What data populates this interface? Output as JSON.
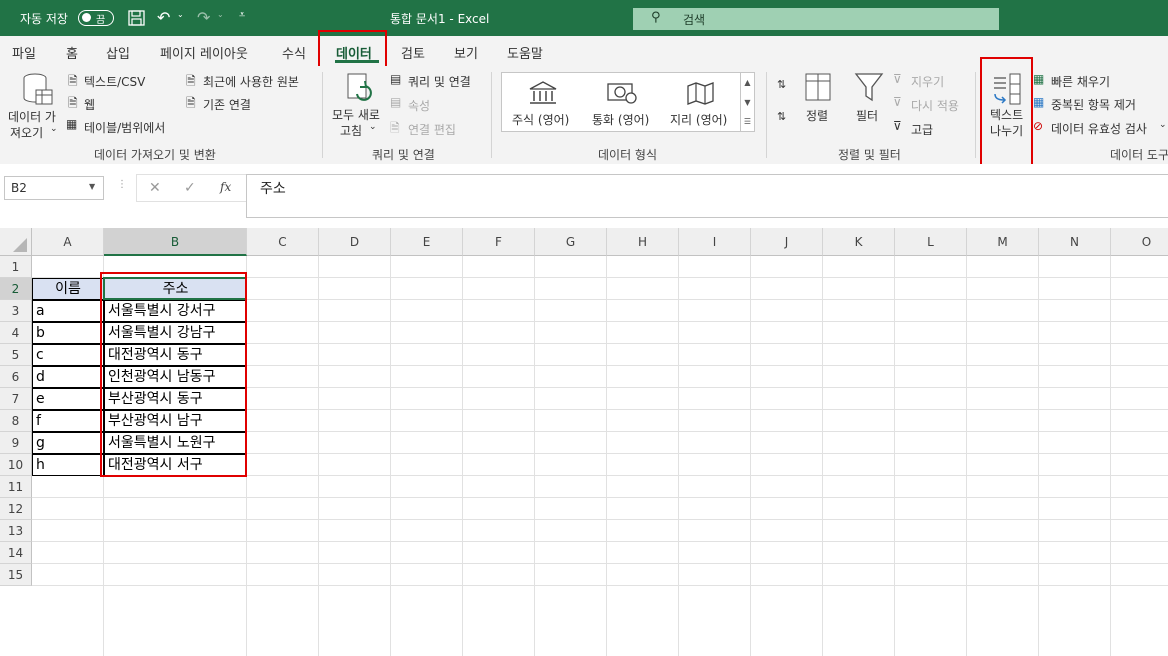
{
  "titlebar": {
    "autosave_label": "자동 저장",
    "autosave_state": "끔",
    "document_title": "통합 문서1 - Excel",
    "search_placeholder": "검색"
  },
  "tabs": [
    "파일",
    "홈",
    "삽입",
    "페이지 레이아웃",
    "수식",
    "데이터",
    "검토",
    "보기",
    "도움말"
  ],
  "active_tab": "데이터",
  "ribbon": {
    "get_data": {
      "button_line1": "데이터 가",
      "button_line2": "져오기",
      "text_csv": "텍스트/CSV",
      "web": "웹",
      "table_range": "테이블/범위에서",
      "recent_sources": "최근에 사용한 원본",
      "existing_connections": "기존 연결",
      "group_label": "데이터 가져오기 및 변환"
    },
    "queries": {
      "refresh_line1": "모두 새로",
      "refresh_line2": "고침",
      "queries_connections": "쿼리 및 연결",
      "properties": "속성",
      "edit_links": "연결 편집",
      "group_label": "쿼리 및 연결"
    },
    "data_types": {
      "stocks": "주식 (영어)",
      "currencies": "통화 (영어)",
      "geography": "지리 (영어)",
      "group_label": "데이터 형식"
    },
    "sort_filter": {
      "sort": "정렬",
      "filter": "필터",
      "clear": "지우기",
      "reapply": "다시 적용",
      "advanced": "고급",
      "group_label": "정렬 및 필터"
    },
    "data_tools": {
      "text_to_columns_line1": "텍스트",
      "text_to_columns_line2": "나누기",
      "flash_fill": "빠른 채우기",
      "remove_duplicates": "중복된 항목 제거",
      "data_validation": "데이터 유효성 검사",
      "group_label": "데이터 도구"
    }
  },
  "formula_bar": {
    "name_box": "B2",
    "fx_symbol": "fx",
    "content": "주소"
  },
  "sheet": {
    "columns": [
      "A",
      "B",
      "C",
      "D",
      "E",
      "F",
      "G",
      "H",
      "I",
      "J",
      "K",
      "L",
      "M",
      "N",
      "O"
    ],
    "selected_column": "B",
    "rows": [
      "1",
      "2",
      "3",
      "4",
      "5",
      "6",
      "7",
      "8",
      "9",
      "10",
      "11",
      "12",
      "13",
      "14",
      "15"
    ],
    "header": {
      "name": "이름",
      "address": "주소"
    },
    "records": [
      {
        "name": "a",
        "address": "서울특별시 강서구"
      },
      {
        "name": "b",
        "address": "서울특별시 강남구"
      },
      {
        "name": "c",
        "address": "대전광역시 동구"
      },
      {
        "name": "d",
        "address": "인천광역시 남동구"
      },
      {
        "name": "e",
        "address": "부산광역시 동구"
      },
      {
        "name": "f",
        "address": "부산광역시 남구"
      },
      {
        "name": "g",
        "address": "서울특별시 노원구"
      },
      {
        "name": "h",
        "address": "대전광역시 서구"
      }
    ]
  },
  "colors": {
    "excel_green": "#217346",
    "highlight_red": "#e00000",
    "header_fill": "#d9e1f2"
  }
}
